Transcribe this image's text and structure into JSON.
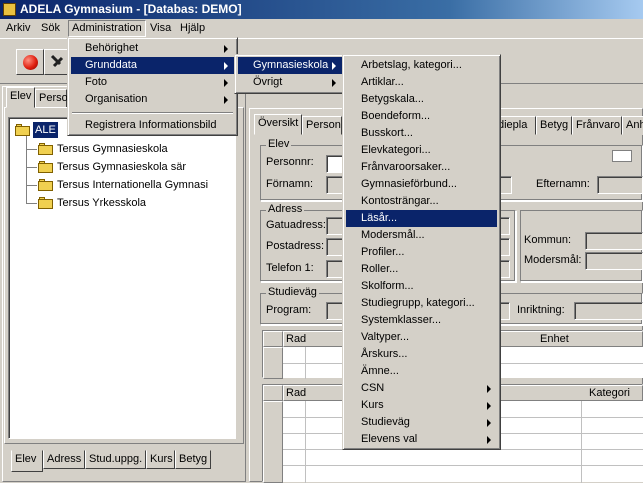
{
  "window": {
    "title": "ADELA Gymnasium - [Databas: DEMO]"
  },
  "menubar": [
    "Arkiv",
    "Sök",
    "Administration",
    "Visa",
    "Hjälp"
  ],
  "admin_menu": {
    "items": [
      {
        "label": "Behörighet",
        "submenu": true
      },
      {
        "label": "Grunddata",
        "submenu": true
      },
      {
        "label": "Foto",
        "submenu": true
      },
      {
        "label": "Organisation",
        "submenu": true
      }
    ],
    "last": "Registrera Informationsbild"
  },
  "grunddata_menu": [
    {
      "label": "Gymnasieskola",
      "submenu": true
    },
    {
      "label": "Övrigt",
      "submenu": true
    }
  ],
  "gymnasieskola_menu": [
    {
      "label": "Arbetslag, kategori...",
      "submenu": false
    },
    {
      "label": "Artiklar...",
      "submenu": false
    },
    {
      "label": "Betygskala...",
      "submenu": false
    },
    {
      "label": "Boendeform...",
      "submenu": false
    },
    {
      "label": "Busskort...",
      "submenu": false
    },
    {
      "label": "Elevkategori...",
      "submenu": false
    },
    {
      "label": "Frånvaroorsaker...",
      "submenu": false
    },
    {
      "label": "Gymnasieförbund...",
      "submenu": false
    },
    {
      "label": "Kontosträngar...",
      "submenu": false
    },
    {
      "label": "Läsår...",
      "submenu": false
    },
    {
      "label": "Modersmål...",
      "submenu": false
    },
    {
      "label": "Profiler...",
      "submenu": false
    },
    {
      "label": "Roller...",
      "submenu": false
    },
    {
      "label": "Skolform...",
      "submenu": false
    },
    {
      "label": "Studiegrupp, kategori...",
      "submenu": false
    },
    {
      "label": "Systemklasser...",
      "submenu": false
    },
    {
      "label": "Valtyper...",
      "submenu": false
    },
    {
      "label": "Årskurs...",
      "submenu": false
    },
    {
      "label": "Ämne...",
      "submenu": false
    },
    {
      "label": "CSN",
      "submenu": true
    },
    {
      "label": "Kurs",
      "submenu": true
    },
    {
      "label": "Studieväg",
      "submenu": true
    },
    {
      "label": "Elevens val",
      "submenu": true
    }
  ],
  "left_top_tabs": [
    "Elev",
    "Perso"
  ],
  "tree": {
    "root": "ALE",
    "children": [
      "Tersus Gymnasieskola",
      "Tersus Gymnasieskola sär",
      "Tersus Internationella Gymnasi",
      "Tersus Yrkesskola"
    ]
  },
  "left_bottom_tabs": [
    "Elev",
    "Adress",
    "Stud.uppg.",
    "Kurs",
    "Betyg"
  ],
  "right_tabs_left": [
    "Översikt",
    "Persona"
  ],
  "right_tabs_right": [
    "diepla",
    "Betyg",
    "Frånvaro",
    "Anh"
  ],
  "form": {
    "elev_group": "Elev",
    "personnr": "Personnr:",
    "fornamn": "Förnamn:",
    "efternamn": "Efternamn:",
    "adress_group": "Adress",
    "gatuadress": "Gatuadress:",
    "postadress": "Postadress:",
    "telefon": "Telefon 1:",
    "kommun": "Kommun:",
    "modersmal": "Modersmål:",
    "studievag_group": "Studieväg",
    "program": "Program:",
    "inriktning": "Inriktning:",
    "grid1": {
      "rad": "Rad",
      "enhet": "Enhet"
    },
    "grid2": {
      "rad": "Rad",
      "kategori": "Kategori"
    }
  }
}
